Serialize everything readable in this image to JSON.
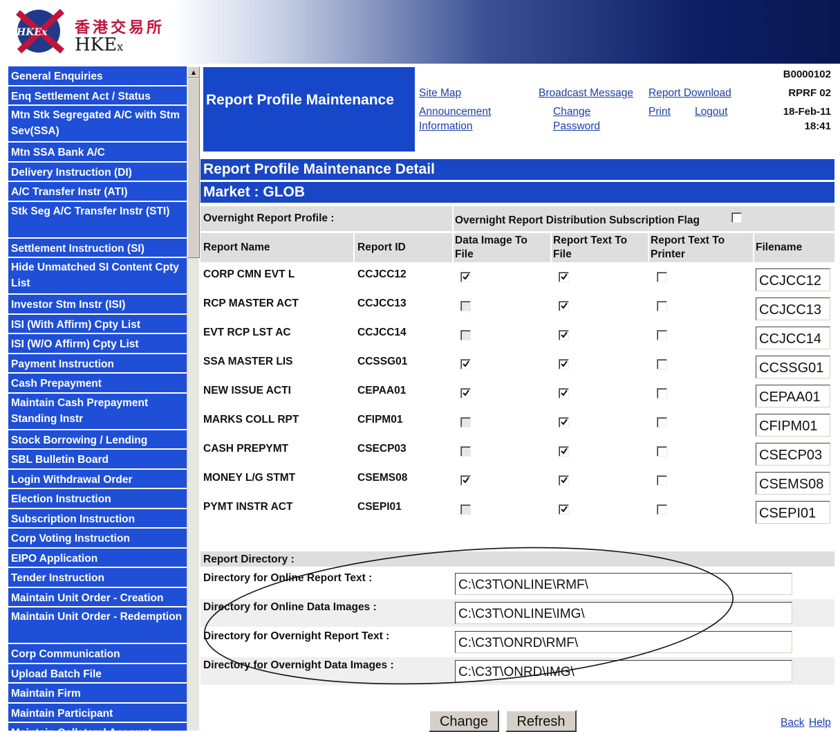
{
  "logo": {
    "chinese": "香港交易所",
    "english_main": "HKE",
    "english_small": "x",
    "mark_text": "HKEx"
  },
  "sidebar": {
    "items": [
      {
        "label": "General Enquiries",
        "lines": 1
      },
      {
        "label": "Enq Settlement Act / Status",
        "lines": 1
      },
      {
        "label": "Mtn Stk Segregated A/C with Stm Sev(SSA)",
        "lines": 2
      },
      {
        "label": "Mtn SSA Bank A/C",
        "lines": 1
      },
      {
        "label": "Delivery Instruction (DI)",
        "lines": 1
      },
      {
        "label": "A/C Transfer Instr (ATI)",
        "lines": 1
      },
      {
        "label": "Stk Seg A/C Transfer Instr (STI)",
        "lines": 2
      },
      {
        "label": "Settlement Instruction (SI)",
        "lines": 1
      },
      {
        "label": "Hide Unmatched SI Content Cpty List",
        "lines": 2
      },
      {
        "label": "Investor Stm Instr (ISI)",
        "lines": 1
      },
      {
        "label": "ISI (With Affirm) Cpty List",
        "lines": 1
      },
      {
        "label": "ISI (W/O Affirm) Cpty List",
        "lines": 1
      },
      {
        "label": "Payment Instruction",
        "lines": 1
      },
      {
        "label": "Cash Prepayment",
        "lines": 1
      },
      {
        "label": "Maintain Cash Prepayment Standing Instr",
        "lines": 2
      },
      {
        "label": "Stock Borrowing / Lending",
        "lines": 1
      },
      {
        "label": "SBL Bulletin Board",
        "lines": 1
      },
      {
        "label": "Login Withdrawal Order",
        "lines": 1
      },
      {
        "label": "Election Instruction",
        "lines": 1
      },
      {
        "label": "Subscription Instruction",
        "lines": 1
      },
      {
        "label": "Corp Voting Instruction",
        "lines": 1
      },
      {
        "label": "EIPO Application",
        "lines": 1
      },
      {
        "label": "Tender Instruction",
        "lines": 1
      },
      {
        "label": "Maintain Unit Order - Creation",
        "lines": 1
      },
      {
        "label": "Maintain Unit Order - Redemption",
        "lines": 2
      },
      {
        "label": "Corp Communication",
        "lines": 1
      },
      {
        "label": "Upload Batch File",
        "lines": 1
      },
      {
        "label": "Maintain Firm",
        "lines": 1
      },
      {
        "label": "Maintain Participant",
        "lines": 1
      },
      {
        "label": "Maintain Collateral Account",
        "lines": 1
      }
    ]
  },
  "header": {
    "title": "Report Profile Maintenance",
    "links": {
      "site_map": "Site Map",
      "broadcast_message": "Broadcast Message",
      "report_download": "Report Download",
      "announcement_l1": "Announcement",
      "announcement_l2": "Information",
      "change_pw_l1": "Change",
      "change_pw_l2": "Password",
      "print": "Print",
      "logout": "Logout"
    },
    "meta": {
      "code1": "B0000102",
      "code2": "RPRF 02",
      "date": "18-Feb-11",
      "time": "18:41"
    }
  },
  "detail_title": "Report Profile Maintenance Detail",
  "market": "Market : GLOB",
  "overnight": {
    "profile_label": "Overnight Report Profile :",
    "subscription_label": "Overnight Report Distribution Subscription Flag",
    "subscription_checked": false
  },
  "table": {
    "headers": {
      "report_name": "Report Name",
      "report_id": "Report ID",
      "data_image_l1": "Data Image To",
      "data_image_l2": "File",
      "text_file_l1": "Report Text To",
      "text_file_l2": "File",
      "text_printer_l1": "Report Text To",
      "text_printer_l2": "Printer",
      "filename": "Filename"
    },
    "rows": [
      {
        "name": "CORP CMN EVT L",
        "id": "CCJCC12",
        "data_image": "checked",
        "text_file": "checked",
        "text_printer": "unchecked",
        "filename": "CCJCC12"
      },
      {
        "name": "RCP MASTER ACT",
        "id": "CCJCC13",
        "data_image": "disabled",
        "text_file": "checked",
        "text_printer": "unchecked",
        "filename": "CCJCC13"
      },
      {
        "name": "EVT RCP LST AC",
        "id": "CCJCC14",
        "data_image": "disabled",
        "text_file": "checked",
        "text_printer": "unchecked",
        "filename": "CCJCC14"
      },
      {
        "name": "SSA MASTER LIS",
        "id": "CCSSG01",
        "data_image": "checked",
        "text_file": "checked",
        "text_printer": "unchecked",
        "filename": "CCSSG01"
      },
      {
        "name": "NEW ISSUE ACTI",
        "id": "CEPAA01",
        "data_image": "checked",
        "text_file": "checked",
        "text_printer": "unchecked",
        "filename": "CEPAA01"
      },
      {
        "name": "MARKS COLL RPT",
        "id": "CFIPM01",
        "data_image": "disabled",
        "text_file": "checked",
        "text_printer": "unchecked",
        "filename": "CFIPM01"
      },
      {
        "name": "CASH PREPYMT",
        "id": "CSECP03",
        "data_image": "disabled",
        "text_file": "checked",
        "text_printer": "unchecked",
        "filename": "CSECP03"
      },
      {
        "name": "MONEY L/G STMT",
        "id": "CSEMS08",
        "data_image": "checked",
        "text_file": "checked",
        "text_printer": "unchecked",
        "filename": "CSEMS08"
      },
      {
        "name": "PYMT INSTR ACT",
        "id": "CSEPI01",
        "data_image": "disabled",
        "text_file": "checked",
        "text_printer": "unchecked",
        "filename": "CSEPI01"
      }
    ]
  },
  "directory": {
    "title": "Report Directory :",
    "rows": [
      {
        "label": "Directory for Online Report Text :",
        "value": "C:\\C3T\\ONLINE\\RMF\\"
      },
      {
        "label": "Directory for Online Data Images :",
        "value": "C:\\C3T\\ONLINE\\IMG\\"
      },
      {
        "label": "Directory for Overnight Report Text :",
        "value": "C:\\C3T\\ONRD\\RMF\\"
      },
      {
        "label": "Directory for Overnight Data Images :",
        "value": "C:\\C3T\\ONRD\\IMG\\"
      }
    ]
  },
  "buttons": {
    "change": "Change",
    "refresh": "Refresh"
  },
  "footer_links": {
    "back": "Back",
    "help": "Help"
  },
  "colors": {
    "nav_blue": "#1f4fd6",
    "header_blue": "#1846c4",
    "link_blue": "#1c3ea8",
    "brand_red": "#c0143c"
  }
}
